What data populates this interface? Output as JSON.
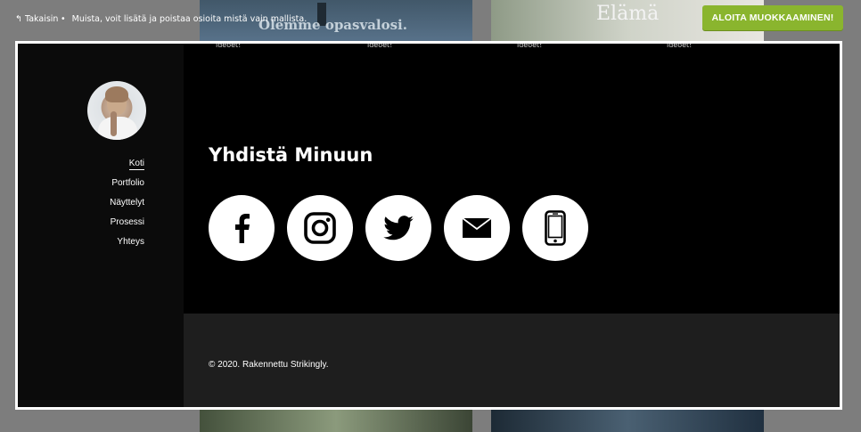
{
  "topbar": {
    "back_label": "Takaisin",
    "separator": "•",
    "tip": "Muista, voit lisätä ja poistaa osioita mistä vain mallista.",
    "start_button": "ALOITA MUOKKAAMINEN!"
  },
  "background": {
    "thumb_a_title": "Olemme opasvalosi.",
    "thumb_b_title": "Elämä",
    "strip_text": "ideoet!"
  },
  "sidebar": {
    "items": [
      {
        "label": "Koti",
        "active": true
      },
      {
        "label": "Portfolio"
      },
      {
        "label": "Näyttelyt"
      },
      {
        "label": "Prosessi"
      },
      {
        "label": "Yhteys"
      }
    ]
  },
  "main": {
    "heading": "Yhdistä Minuun",
    "socials": [
      "facebook-icon",
      "instagram-icon",
      "twitter-icon",
      "mail-icon",
      "phone-icon"
    ]
  },
  "footer": {
    "copyright": "© 2020. Rakennettu Strikingly."
  },
  "colors": {
    "accent": "#8ab52e",
    "page_bg": "#000000",
    "footer_bg": "#1e1e1e"
  }
}
